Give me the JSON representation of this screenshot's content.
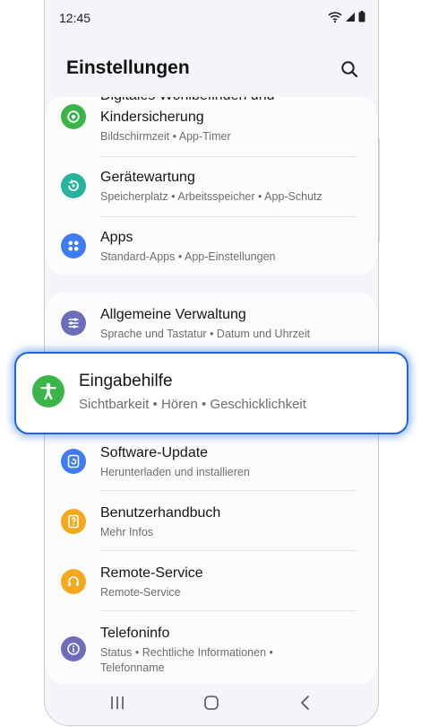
{
  "status_bar": {
    "time": "12:45"
  },
  "header": {
    "title": "Einstellungen",
    "search_icon": "search-icon"
  },
  "settings_groups": [
    {
      "items": [
        {
          "title": "Digitales Wohlbefinden und",
          "title_line2": "Kindersicherung",
          "subtitle": "Bildschirmzeit • App-Timer",
          "icon": "digital-wellbeing-icon",
          "color": "#3bb54a"
        },
        {
          "title": "Gerätewartung",
          "subtitle": "Speicherplatz • Arbeitsspeicher • App-Schutz",
          "icon": "device-care-icon",
          "color": "#26b29c"
        },
        {
          "title": "Apps",
          "subtitle": "Standard-Apps • App-Einstellungen",
          "icon": "apps-icon",
          "color": "#3e7cf0"
        }
      ]
    },
    {
      "items": [
        {
          "title": "Allgemeine Verwaltung",
          "subtitle": "Sprache und Tastatur • Datum und Uhrzeit",
          "icon": "general-management-icon",
          "color": "#6e6dba"
        },
        {
          "title": "Software-Update",
          "subtitle": "Herunterladen und installieren",
          "icon": "software-update-icon",
          "color": "#3e7cf0"
        },
        {
          "title": "Benutzerhandbuch",
          "subtitle": "Mehr Infos",
          "icon": "user-manual-icon",
          "color": "#f3a81d"
        },
        {
          "title": "Remote-Service",
          "subtitle": "Remote-Service",
          "icon": "remote-service-icon",
          "color": "#f3a81d"
        },
        {
          "title": "Telefoninfo",
          "subtitle": "Status • Rechtliche Informationen •",
          "subtitle_line2": "Telefonname",
          "icon": "phone-info-icon",
          "color": "#6e6dba"
        }
      ]
    }
  ],
  "highlighted_item": {
    "title": "Eingabehilfe",
    "subtitle": "Sichtbarkeit  •  Hören  •  Geschicklichkeit",
    "icon": "accessibility-icon",
    "color": "#3bb54a",
    "border_color": "#1f67d6"
  },
  "nav_bar": {
    "recents_icon": "recents-icon",
    "home_icon": "home-icon",
    "back_icon": "back-icon"
  }
}
